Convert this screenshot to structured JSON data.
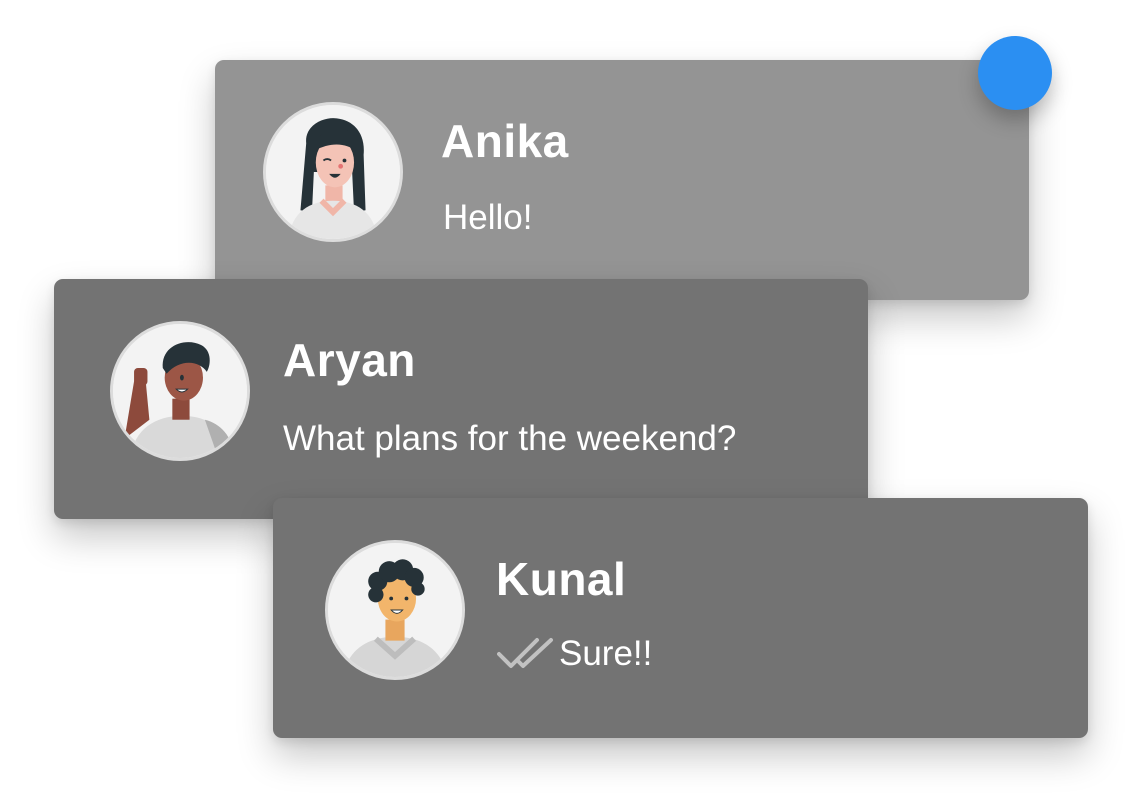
{
  "notification": {
    "color": "#2b8ff2"
  },
  "chats": [
    {
      "name": "Anika",
      "message": "Hello!",
      "avatar_icon": "female-avatar-icon"
    },
    {
      "name": "Aryan",
      "message": "What plans for the weekend?",
      "avatar_icon": "male-waving-avatar-icon"
    },
    {
      "name": "Kunal",
      "message": "Sure!!",
      "avatar_icon": "male-curly-hair-avatar-icon",
      "status_icon": "double-check-icon"
    }
  ]
}
